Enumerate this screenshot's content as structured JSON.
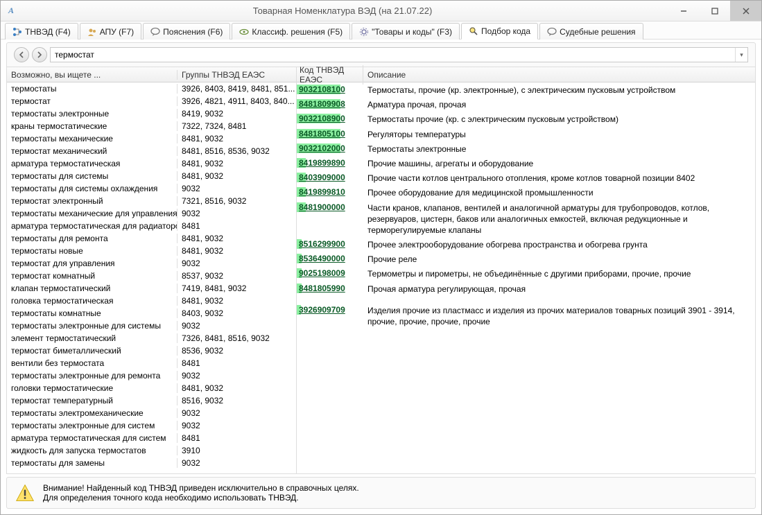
{
  "window": {
    "title": "Товарная Номенклатура ВЭД (на 21.07.22)"
  },
  "tabs": [
    {
      "label": "ТНВЭД (F4)",
      "icon": "tree"
    },
    {
      "label": "АПУ (F7)",
      "icon": "people"
    },
    {
      "label": "Пояснения (F6)",
      "icon": "chat"
    },
    {
      "label": "Классиф. решения (F5)",
      "icon": "eye"
    },
    {
      "label": "\"Товары и коды\" (F3)",
      "icon": "gear"
    },
    {
      "label": "Подбор кода",
      "icon": "search",
      "active": true
    },
    {
      "label": "Судебные решения",
      "icon": "chat"
    }
  ],
  "search": {
    "value": "термостат"
  },
  "leftGrid": {
    "headers": {
      "c1": "Возможно, вы ищете ...",
      "c2": "Группы ТНВЭД ЕАЭС"
    },
    "rows": [
      {
        "t": "термостаты",
        "g": "3926, 8403, 8419, 8481, 851..."
      },
      {
        "t": "термостат",
        "g": "3926, 4821, 4911, 8403, 840..."
      },
      {
        "t": "термостаты электронные",
        "g": "8419, 9032"
      },
      {
        "t": "краны термостатические",
        "g": "7322, 7324, 8481"
      },
      {
        "t": "термостаты механические",
        "g": "8481, 9032"
      },
      {
        "t": "термостат механический",
        "g": "8481, 8516, 8536, 9032"
      },
      {
        "t": "арматура термостатическая",
        "g": "8481, 9032"
      },
      {
        "t": "термостаты для системы",
        "g": "8481, 9032"
      },
      {
        "t": "термостаты для системы охлаждения",
        "g": "9032"
      },
      {
        "t": "термостат электронный",
        "g": "7321, 8516, 9032"
      },
      {
        "t": "термостаты механические для управления",
        "g": "9032"
      },
      {
        "t": "арматура термостатическая для радиаторов",
        "g": "8481"
      },
      {
        "t": "термостаты для ремонта",
        "g": "8481, 9032"
      },
      {
        "t": "термостаты новые",
        "g": "8481, 9032"
      },
      {
        "t": "термостат для управления",
        "g": "9032"
      },
      {
        "t": "термостат комнатный",
        "g": "8537, 9032"
      },
      {
        "t": "клапан термостатический",
        "g": "7419, 8481, 9032"
      },
      {
        "t": "головка термостатическая",
        "g": "8481, 9032"
      },
      {
        "t": "термостаты комнатные",
        "g": "8403, 9032"
      },
      {
        "t": "термостаты электронные для системы",
        "g": "9032"
      },
      {
        "t": "элемент термостатический",
        "g": "7326, 8481, 8516, 9032"
      },
      {
        "t": "термостат биметаллический",
        "g": "8536, 9032"
      },
      {
        "t": "вентили без термостата",
        "g": "8481"
      },
      {
        "t": "термостаты электронные для ремонта",
        "g": "9032"
      },
      {
        "t": "головки термостатические",
        "g": "8481, 9032"
      },
      {
        "t": "термостат температурный",
        "g": "8516, 9032"
      },
      {
        "t": "термостаты электромеханические",
        "g": "9032"
      },
      {
        "t": "термостаты электронные для систем",
        "g": "9032"
      },
      {
        "t": "арматура термостатическая для систем",
        "g": "8481"
      },
      {
        "t": "жидкость для запуска термостатов",
        "g": "3910"
      },
      {
        "t": "термостаты для замены",
        "g": "9032"
      }
    ]
  },
  "rightGrid": {
    "headers": {
      "c1": "Код ТНВЭД ЕАЭС",
      "c2": "Описание"
    },
    "rows": [
      {
        "rel": 86,
        "code": "9032108100",
        "desc": "Термостаты, прочие (кр. электронные), с электрическим пусковым устройством"
      },
      {
        "rel": 86,
        "code": "8481809908",
        "desc": "Арматура прочая, прочая"
      },
      {
        "rel": 86,
        "code": "9032108900",
        "desc": "Термостаты прочие (кр. с электрическим пусковым устройством)"
      },
      {
        "rel": 86,
        "code": "8481805100",
        "desc": "Регуляторы температуры"
      },
      {
        "rel": 86,
        "code": "9032102000",
        "desc": "Термостаты электронные"
      },
      {
        "rel": 18,
        "code": "8419899890",
        "desc": "Прочие машины, агрегаты и оборудование"
      },
      {
        "rel": 18,
        "code": "8403909000",
        "desc": "Прочие части котлов центрального отопления, кроме котлов товарной позиции 8402"
      },
      {
        "rel": 18,
        "code": "8419899810",
        "desc": "Прочее оборудование для медицинской промышленности"
      },
      {
        "rel": 18,
        "code": "8481900000",
        "desc": "Части кранов, клапанов, вентилей и аналогичной арматуры для трубопроводов, котлов, резервуаров, цистерн, баков или аналогичных емкостей, включая редукционные и терморегулируемые клапаны"
      },
      {
        "rel": 10,
        "code": "8516299900",
        "desc": "Прочее электрооборудование обогрева пространства и обогрева грунта"
      },
      {
        "rel": 10,
        "code": "8536490000",
        "desc": "Прочие реле"
      },
      {
        "rel": 10,
        "code": "9025198009",
        "desc": "Термометры и пирометры, не объединённые с другими приборами, прочие, прочие"
      },
      {
        "rel": 10,
        "code": "8481805990",
        "desc": "Прочая арматура регулирующая, прочая"
      },
      {
        "rel": 8,
        "code": "3926909709",
        "desc": "Изделия прочие из пластмасс и изделия из прочих материалов товарных позиций 3901 - 3914, прочие, прочие, прочие, прочие"
      }
    ]
  },
  "footer": {
    "line1": "Внимание! Найденный код ТНВЭД приведен исключительно в справочных целях.",
    "line2": "Для определения точного кода необходимо использовать ТНВЭД."
  }
}
